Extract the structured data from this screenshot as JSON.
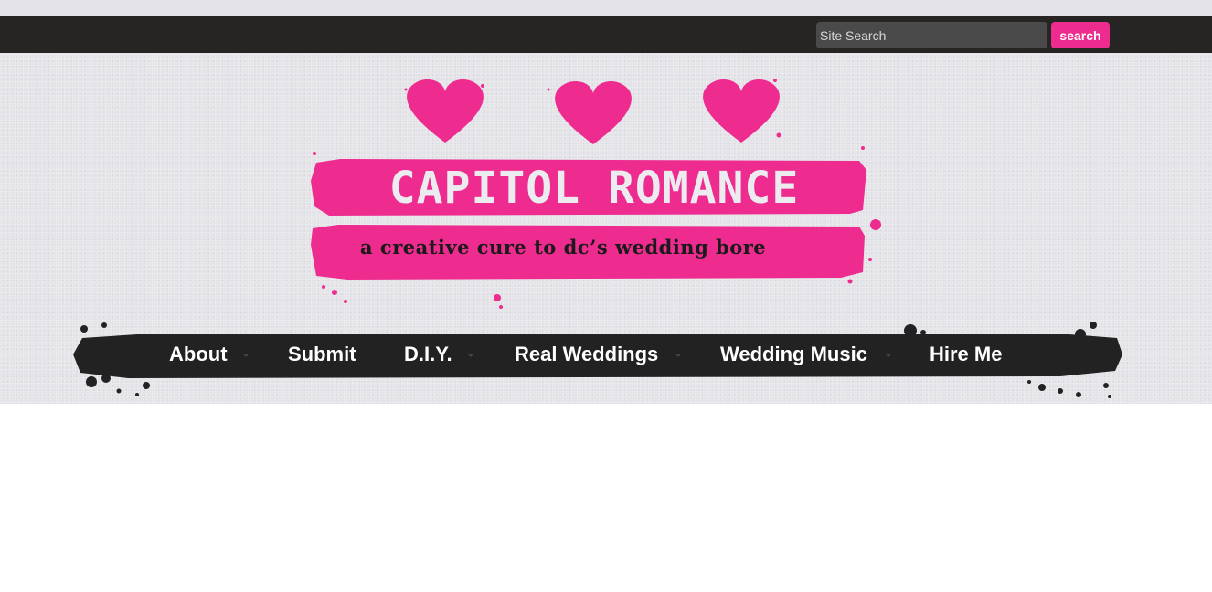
{
  "colors": {
    "brand_pink": "#ee2b8e",
    "topbar_bg": "#262523",
    "nav_bg": "#222222"
  },
  "search": {
    "placeholder": "Site Search",
    "button_label": "search"
  },
  "logo": {
    "title": "CAPITOL ROMANCE",
    "tagline": "a creative cure to dc’s wedding bore",
    "icons": [
      "heart-icon",
      "heart-icon",
      "heart-icon"
    ]
  },
  "nav": {
    "items": [
      {
        "label": "About",
        "has_dropdown": true
      },
      {
        "label": "Submit",
        "has_dropdown": false
      },
      {
        "label": "D.I.Y.",
        "has_dropdown": true
      },
      {
        "label": "Real Weddings",
        "has_dropdown": true
      },
      {
        "label": "Wedding Music",
        "has_dropdown": true
      },
      {
        "label": "Hire Me",
        "has_dropdown": false
      }
    ]
  }
}
